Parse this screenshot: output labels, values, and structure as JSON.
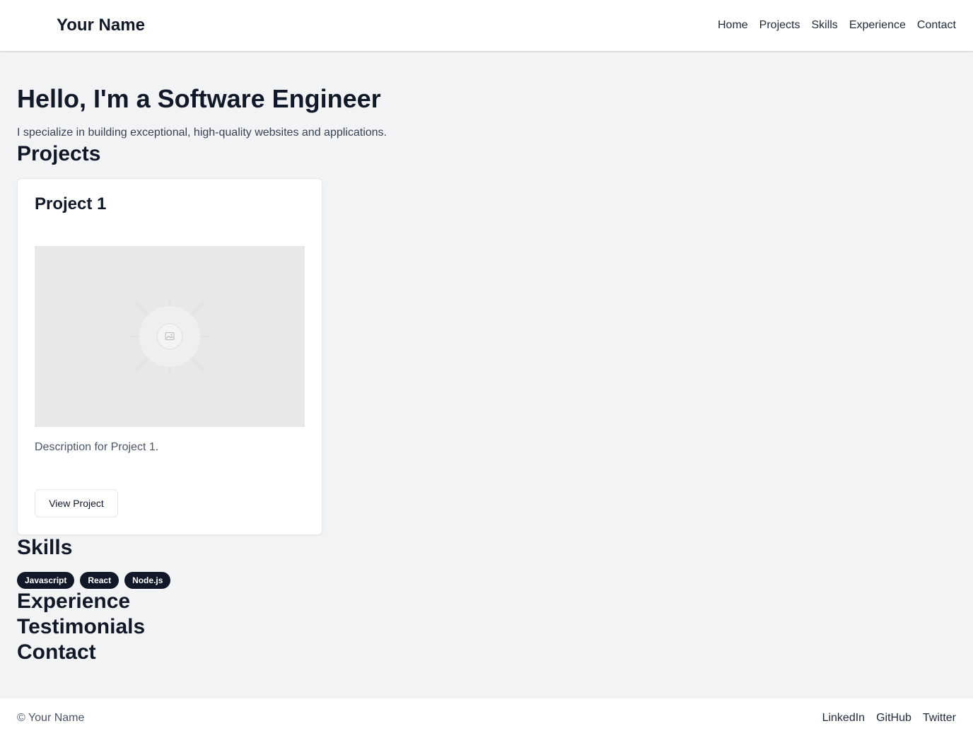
{
  "header": {
    "brand": "Your Name",
    "nav": [
      "Home",
      "Projects",
      "Skills",
      "Experience",
      "Contact"
    ]
  },
  "hero": {
    "title": "Hello, I'm a Software Engineer",
    "subtitle": "I specialize in building exceptional, high-quality websites and applications."
  },
  "projects": {
    "heading": "Projects",
    "items": [
      {
        "title": "Project 1",
        "image_icon": "image-placeholder-icon",
        "description": "Description for Project 1.",
        "button_label": "View Project"
      }
    ]
  },
  "skills": {
    "heading": "Skills",
    "items": [
      "Javascript",
      "React",
      "Node.js"
    ]
  },
  "experience": {
    "heading": "Experience"
  },
  "testimonials": {
    "heading": "Testimonials"
  },
  "contact": {
    "heading": "Contact"
  },
  "footer": {
    "copyright": "© Your Name",
    "links": [
      "LinkedIn",
      "GitHub",
      "Twitter"
    ]
  },
  "colors": {
    "page_background": "#f2f3f5",
    "badge_background": "#111827",
    "text_primary": "#111827"
  }
}
